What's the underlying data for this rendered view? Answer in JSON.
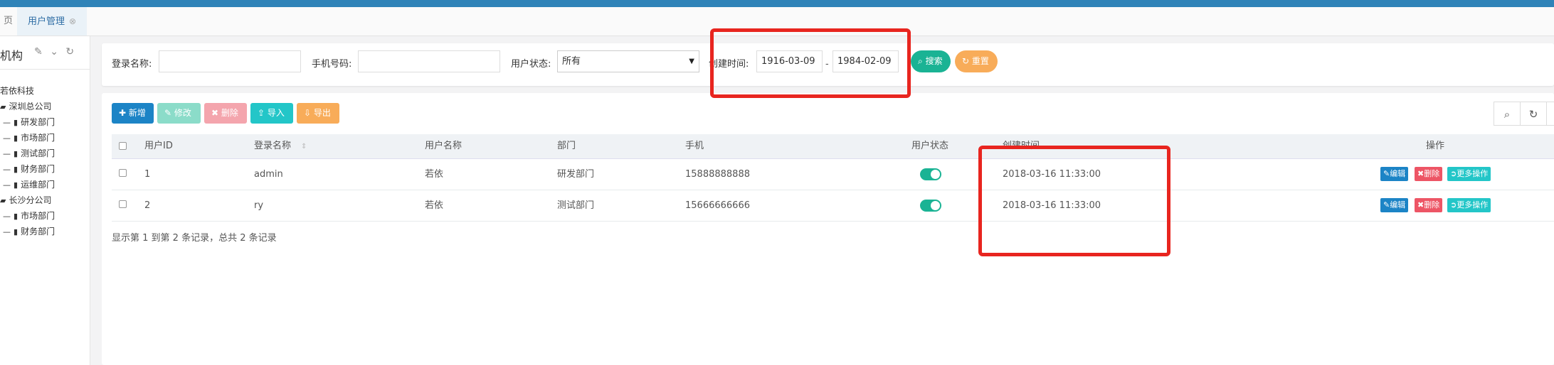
{
  "tabs": {
    "home_label": "页",
    "active_label": "用户管理",
    "close_glyph": "⊗"
  },
  "sidebar": {
    "title": "机构",
    "tools": [
      "edit-icon",
      "chevron-down-icon",
      "refresh-icon"
    ],
    "tree": [
      {
        "label": "若依科技",
        "level": 0,
        "icon": "none"
      },
      {
        "label": "深圳总公司",
        "level": 0,
        "icon": "folder-open-icon"
      },
      {
        "label": "研发部门",
        "level": 1,
        "icon": "file-icon"
      },
      {
        "label": "市场部门",
        "level": 1,
        "icon": "file-icon"
      },
      {
        "label": "测试部门",
        "level": 1,
        "icon": "file-icon"
      },
      {
        "label": "财务部门",
        "level": 1,
        "icon": "file-icon"
      },
      {
        "label": "运维部门",
        "level": 1,
        "icon": "file-icon"
      },
      {
        "label": "长沙分公司",
        "level": 0,
        "icon": "folder-open-icon"
      },
      {
        "label": "市场部门",
        "level": 1,
        "icon": "file-icon"
      },
      {
        "label": "财务部门",
        "level": 1,
        "icon": "file-icon"
      }
    ]
  },
  "search": {
    "login_name_label": "登录名称:",
    "login_name_value": "",
    "phone_label": "手机号码:",
    "phone_value": "",
    "status_label": "用户状态:",
    "status_value": "所有",
    "created_label": "创建时间:",
    "date_from": "1916-03-09",
    "date_sep": "-",
    "date_to": "1984-02-09",
    "search_btn": "搜索",
    "reset_btn": "重置"
  },
  "toolbar": {
    "add": "新增",
    "edit": "修改",
    "delete": "删除",
    "import": "导入",
    "export": "导出"
  },
  "table": {
    "columns": [
      "用户ID",
      "登录名称",
      "用户名称",
      "部门",
      "手机",
      "用户状态",
      "创建时间",
      "操作"
    ],
    "rows": [
      {
        "id": "1",
        "login": "admin",
        "name": "若依",
        "dept": "研发部门",
        "phone": "15888888888",
        "status_on": true,
        "created": "2018-03-16 11:33:00"
      },
      {
        "id": "2",
        "login": "ry",
        "name": "若依",
        "dept": "测试部门",
        "phone": "15666666666",
        "status_on": true,
        "created": "2018-03-16 11:33:00"
      }
    ],
    "actions": {
      "edit": "编辑",
      "delete": "删除",
      "more": "更多操作"
    },
    "footer": "显示第 1 到第 2 条记录，总共 2 条记录"
  },
  "colors": {
    "topbar": "#2f83b8",
    "primary": "#1c84c6",
    "success": "#1ab394",
    "warning": "#f8ac59",
    "danger": "#ed5565",
    "info": "#23c6c8",
    "annotation": "#e8251f"
  }
}
